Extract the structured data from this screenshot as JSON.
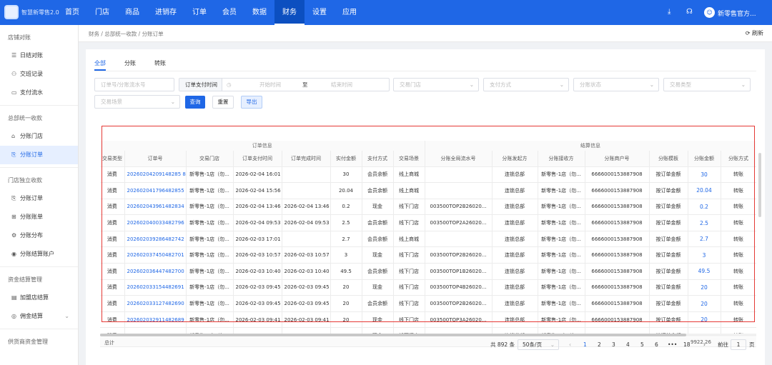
{
  "app": {
    "name": "智慧新零售2.0"
  },
  "nav": [
    "首页",
    "门店",
    "商品",
    "进销存",
    "订单",
    "会员",
    "数据",
    "财务",
    "设置",
    "应用"
  ],
  "nav_active_index": 7,
  "user": {
    "name": "新零售官方..."
  },
  "sidebar": {
    "sections": [
      {
        "title": "店铺对账",
        "items": [
          {
            "icon": "doc-list-icon",
            "label": "日结对账"
          },
          {
            "icon": "person-icon",
            "label": "交班记录"
          },
          {
            "icon": "card-icon",
            "label": "支付流水"
          }
        ]
      },
      {
        "title": "总部统一收款",
        "items": [
          {
            "icon": "store-icon",
            "label": "分账门店"
          },
          {
            "icon": "split-order-icon",
            "label": "分账订单",
            "active": true
          }
        ]
      },
      {
        "title": "门店独立收款",
        "items": [
          {
            "icon": "split-order-icon",
            "label": "分账订单"
          },
          {
            "icon": "ledger-icon",
            "label": "分账账单"
          },
          {
            "icon": "distribution-icon",
            "label": "分账分布"
          },
          {
            "icon": "account-icon",
            "label": "分账结算账户"
          }
        ]
      },
      {
        "title": "资金结算管理",
        "items": [
          {
            "icon": "wallet-icon",
            "label": "加盟店结算"
          },
          {
            "icon": "commission-icon",
            "label": "佣金结算",
            "expandable": true
          }
        ]
      },
      {
        "title": "供货商资金管理",
        "items": []
      }
    ]
  },
  "breadcrumb": "财务 / 总部统一收款 / 分账订单",
  "refresh_label": "刷新",
  "tabs": [
    "全部",
    "分账",
    "转账"
  ],
  "filters": {
    "order_search_placeholder": "订单号/分账流水号",
    "time_type": "订单支付时间",
    "start_placeholder": "开始时间",
    "range_sep": "至",
    "end_placeholder": "结束时间",
    "store_placeholder": "交易门店",
    "pay_method_placeholder": "支付方式",
    "split_status_placeholder": "分账状态",
    "trade_type_placeholder": "交易类型",
    "scene_placeholder": "交易场景",
    "query": "查询",
    "reset": "重置",
    "export": "导出"
  },
  "table": {
    "group_headers": {
      "order_info": "订单信息",
      "split_info": "结算信息"
    },
    "columns": [
      "交易类型",
      "订单号",
      "交易门店",
      "订单支付时间",
      "订单完成时间",
      "实付金额",
      "支付方式",
      "交易场景",
      "分账全局流水号",
      "分账发起方",
      "分账接收方",
      "分账商户号",
      "分账模板",
      "分账金额",
      "分账方式"
    ],
    "rows": [
      [
        "消费",
        "20260204209148285 8",
        "新零售-1店（勿...",
        "2026-02-04 16:01",
        "",
        "30",
        "会员余额",
        "线上商城",
        "",
        "连锁总部",
        "新零售-1店（勿...",
        "6666000153887908",
        "按订单金额",
        "30",
        "转账"
      ],
      [
        "消费",
        "202602041796482855",
        "新零售-1店（勿...",
        "2026-02-04 15:56",
        "",
        "20.04",
        "会员余额",
        "线上商城",
        "",
        "连锁总部",
        "新零售-1店（勿...",
        "6666000153887908",
        "按订单金额",
        "20.04",
        "转账"
      ],
      [
        "消费",
        "202602043961482834",
        "新零售-1店（勿...",
        "2026-02-04 13:46",
        "2026-02-04 13:46",
        "0.2",
        "现金",
        "线下门店",
        "003500TOP2B26020...",
        "连锁总部",
        "新零售-1店（勿...",
        "6666000153887908",
        "按订单金额",
        "0.2",
        "转账"
      ],
      [
        "消费",
        "202602040033482796",
        "新零售-1店（勿...",
        "2026-02-04 09:53",
        "2026-02-04 09:53",
        "2.5",
        "会员余额",
        "线下门店",
        "003500TOP2A26020...",
        "连锁总部",
        "新零售-1店（勿...",
        "6666000153887908",
        "按订单金额",
        "2.5",
        "转账"
      ],
      [
        "消费",
        "202602039286482742",
        "新零售-1店（勿...",
        "2026-02-03 17:01",
        "",
        "2.7",
        "会员余额",
        "线上商城",
        "",
        "连锁总部",
        "新零售-1店（勿...",
        "6666000153887908",
        "按订单金额",
        "2.7",
        "转账"
      ],
      [
        "消费",
        "202602037450482701",
        "新零售-1店（勿...",
        "2026-02-03 10:57",
        "2026-02-03 10:57",
        "3",
        "现金",
        "线下门店",
        "003500TOP2B26020...",
        "连锁总部",
        "新零售-1店（勿...",
        "6666000153887908",
        "按订单金额",
        "3",
        "转账"
      ],
      [
        "消费",
        "202602036447482700",
        "新零售-1店（勿...",
        "2026-02-03 10:40",
        "2026-02-03 10:40",
        "49.5",
        "会员余额",
        "线下门店",
        "003500TOP1B26020...",
        "连锁总部",
        "新零售-1店（勿...",
        "6666000153887908",
        "按订单金额",
        "49.5",
        "转账"
      ],
      [
        "消费",
        "202602033154482691",
        "新零售-1店（勿...",
        "2026-02-03 09:45",
        "2026-02-03 09:45",
        "20",
        "现金",
        "线下门店",
        "003500TOP4B26020...",
        "连锁总部",
        "新零售-1店（勿...",
        "6666000153887908",
        "按订单金额",
        "20",
        "转账"
      ],
      [
        "消费",
        "202602033127482690",
        "新零售-1店（勿...",
        "2026-02-03 09:45",
        "2026-02-03 09:45",
        "20",
        "会员余额",
        "线下门店",
        "003500TOP2B26020...",
        "连锁总部",
        "新零售-1店（勿...",
        "6666000153887908",
        "按订单金额",
        "20",
        "转账"
      ],
      [
        "消费",
        "202602032911482689",
        "新零售-1店（勿...",
        "2026-02-03 09:41",
        "2026-02-03 09:41",
        "20",
        "现金",
        "线下门店",
        "003500TOP3A26020...",
        "连锁总部",
        "新零售-1店（勿...",
        "6666000153887908",
        "按订单金额",
        "20",
        "转账"
      ],
      [
        "消费",
        "202602030064482685",
        "新零售-1店（勿...",
        "2026-02-03 09:54",
        "2026-02-03 09:54",
        "5",
        "现金",
        "线下门店",
        "003500TOP2B26020...",
        "连锁总部",
        "新零售-1店（勿...",
        "6666000153887908",
        "按订单金额",
        "5",
        "转账"
      ]
    ],
    "total_label": "总计",
    "total_split_amount": "9922.26"
  },
  "pagination": {
    "total": "共 892 条",
    "page_size": "50条/页",
    "pages": [
      "1",
      "2",
      "3",
      "4",
      "5",
      "6",
      "•••",
      "18"
    ],
    "current_page": "1",
    "goto_label": "前往",
    "goto_value": "1",
    "page_unit": "页"
  }
}
